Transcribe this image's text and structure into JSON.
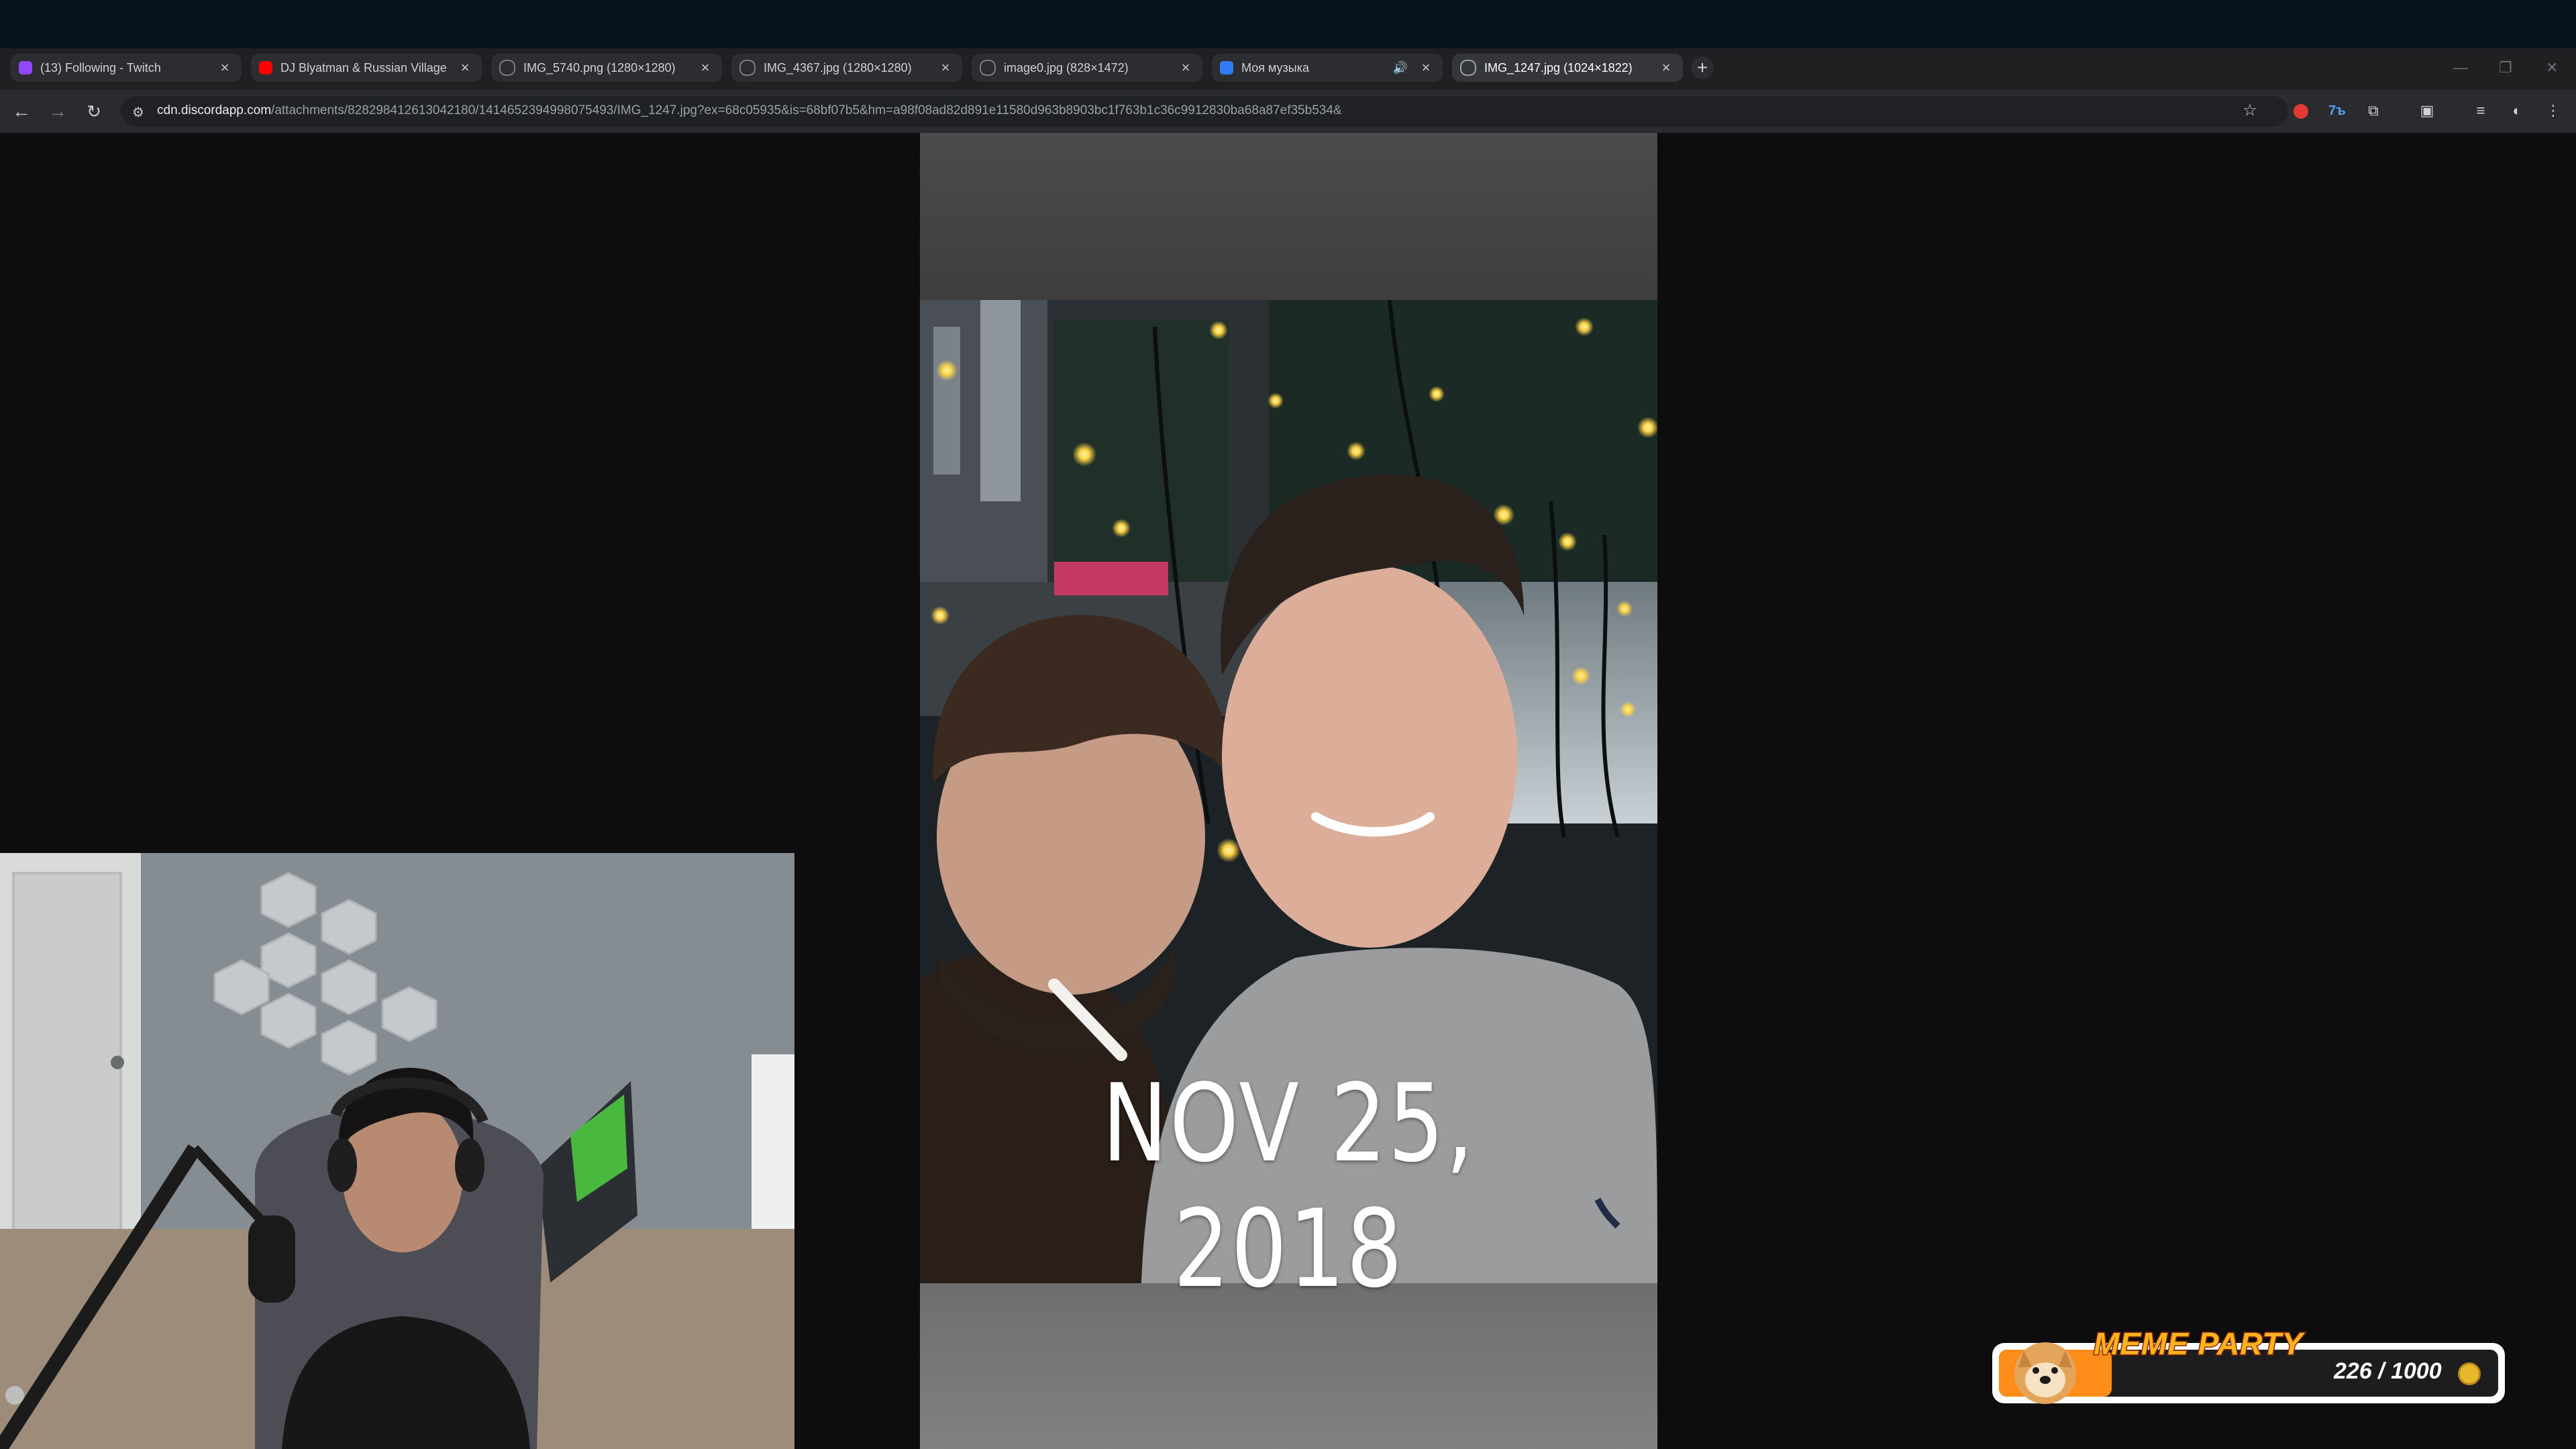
{
  "browser": {
    "tabs": [
      {
        "label": "(13) Following - Twitch",
        "favicon": "twitch-icon",
        "color": "#9146ff"
      },
      {
        "label": "DJ Blyatman & Russian Village",
        "favicon": "youtube-icon",
        "color": "#ff0000"
      },
      {
        "label": "IMG_5740.png (1280×1280)",
        "favicon": "globe-icon",
        "color": "#7b7d80"
      },
      {
        "label": "IMG_4367.jpg (1280×1280)",
        "favicon": "globe-icon",
        "color": "#7b7d80"
      },
      {
        "label": "image0.jpg (828×1472)",
        "favicon": "globe-icon",
        "color": "#7b7d80"
      },
      {
        "label": "Моя музыка",
        "favicon": "music-play-icon",
        "color": "#2f7cf6"
      },
      {
        "label": "IMG_1247.jpg (1024×1822)",
        "favicon": "globe-icon",
        "color": "#7b7d80"
      }
    ],
    "active_tab": 6,
    "url_host": "cdn.discordapp.com",
    "url_path": "/attachments/828298412613042180/1414652394998075493/IMG_1247.jpg?ex=68c05935&is=68bf07b5&hm=a98f08ad82d891e11580d963b8903bc1f763b1c36c9912830ba68a87ef35b534&"
  },
  "image": {
    "caption": "NOV 25, 2018"
  },
  "overlay": {
    "title": "MEME PARTY",
    "progress_text": "226 / 1000",
    "progress_value": 226,
    "progress_max": 1000,
    "accent": "#ffb21e",
    "bar_color": "#1d1d1f"
  }
}
